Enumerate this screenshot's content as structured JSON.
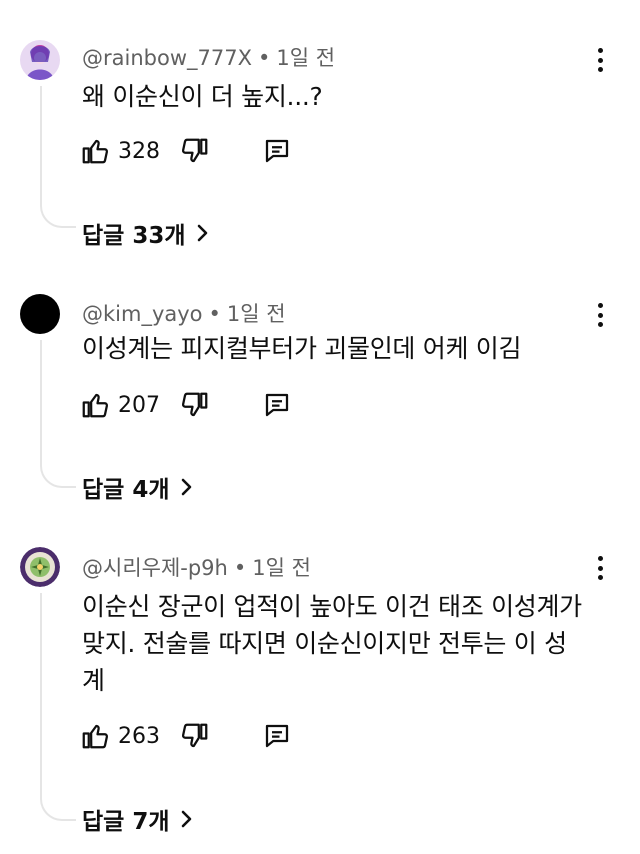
{
  "comments": [
    {
      "handle": "@rainbow_777X",
      "time": "1일 전",
      "text": "왜 이순신이 더 높지...?",
      "likes": "328",
      "replies_label": "답글 33개"
    },
    {
      "handle": "@kim_yayo",
      "time": "1일 전",
      "text": "이성계는 피지컬부터가 괴물인데 어케 이김",
      "likes": "207",
      "replies_label": "답글 4개"
    },
    {
      "handle": "@시리우제-p9h",
      "time": "1일 전",
      "text": "이순신 장군이 업적이 높아도 이건 태조 이성계가 맞지. 전술를 따지면 이순신이지만 전투는 이 성계",
      "likes": "263",
      "replies_label": "답글 7개"
    }
  ],
  "separator": "•",
  "icons": {
    "like": "thumbs-up-icon",
    "dislike": "thumbs-down-icon",
    "reply": "reply-icon",
    "more": "more-vert-icon",
    "chevron": "chevron-right-icon"
  }
}
